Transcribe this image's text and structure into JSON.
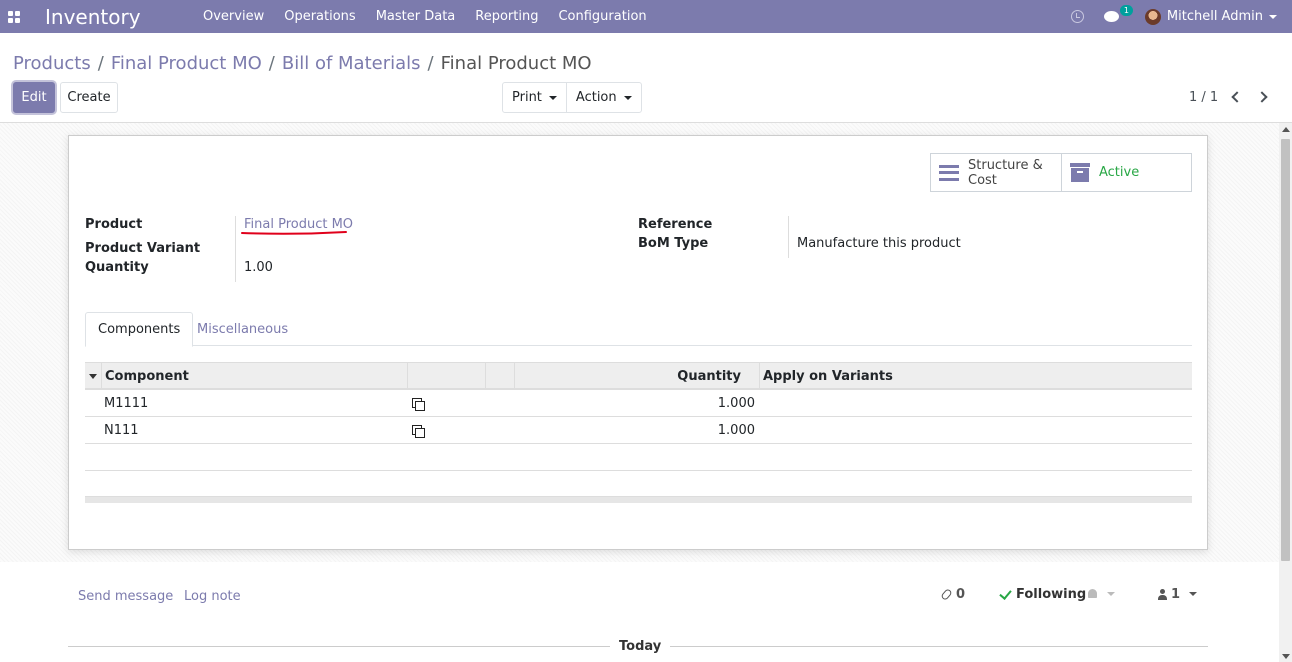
{
  "navbar": {
    "brand": "Inventory",
    "menu": [
      "Overview",
      "Operations",
      "Master Data",
      "Reporting",
      "Configuration"
    ],
    "chat_badge": "1",
    "user_name": "Mitchell Admin"
  },
  "breadcrumb": {
    "items": [
      "Products",
      "Final Product MO",
      "Bill of Materials"
    ],
    "current": "Final Product MO"
  },
  "buttons": {
    "edit": "Edit",
    "create": "Create",
    "print": "Print",
    "action": "Action"
  },
  "pager": {
    "value": "1 / 1"
  },
  "button_box": {
    "structure_line1": "Structure &",
    "structure_line2": "Cost",
    "active": "Active"
  },
  "fields": {
    "product_label": "Product",
    "product_value": "Final Product MO",
    "variant_label": "Product Variant",
    "quantity_label": "Quantity",
    "quantity_value": "1.00",
    "reference_label": "Reference",
    "bom_type_label": "BoM Type",
    "bom_type_value": "Manufacture this product"
  },
  "tabs": [
    "Components",
    "Miscellaneous"
  ],
  "components_table": {
    "headers": {
      "component": "Component",
      "quantity": "Quantity",
      "apply": "Apply on Variants"
    },
    "rows": [
      {
        "component": "M1111",
        "quantity": "1.000"
      },
      {
        "component": "N111",
        "quantity": "1.000"
      }
    ]
  },
  "chatter": {
    "send_message": "Send message",
    "log_note": "Log note",
    "attachments": "0",
    "following": "Following",
    "followers": "1",
    "today": "Today"
  },
  "colors": {
    "brand": "#7c7bad",
    "active": "#28a745",
    "underline_annotation": "#e0001b"
  },
  "icons": [
    "apps-icon",
    "clock-icon",
    "chat-icon",
    "avatar",
    "chevron-left-icon",
    "chevron-right-icon",
    "bars-icon",
    "archive-icon",
    "copy-icon",
    "paperclip-icon",
    "check-icon",
    "bell-icon",
    "user-icon"
  ]
}
